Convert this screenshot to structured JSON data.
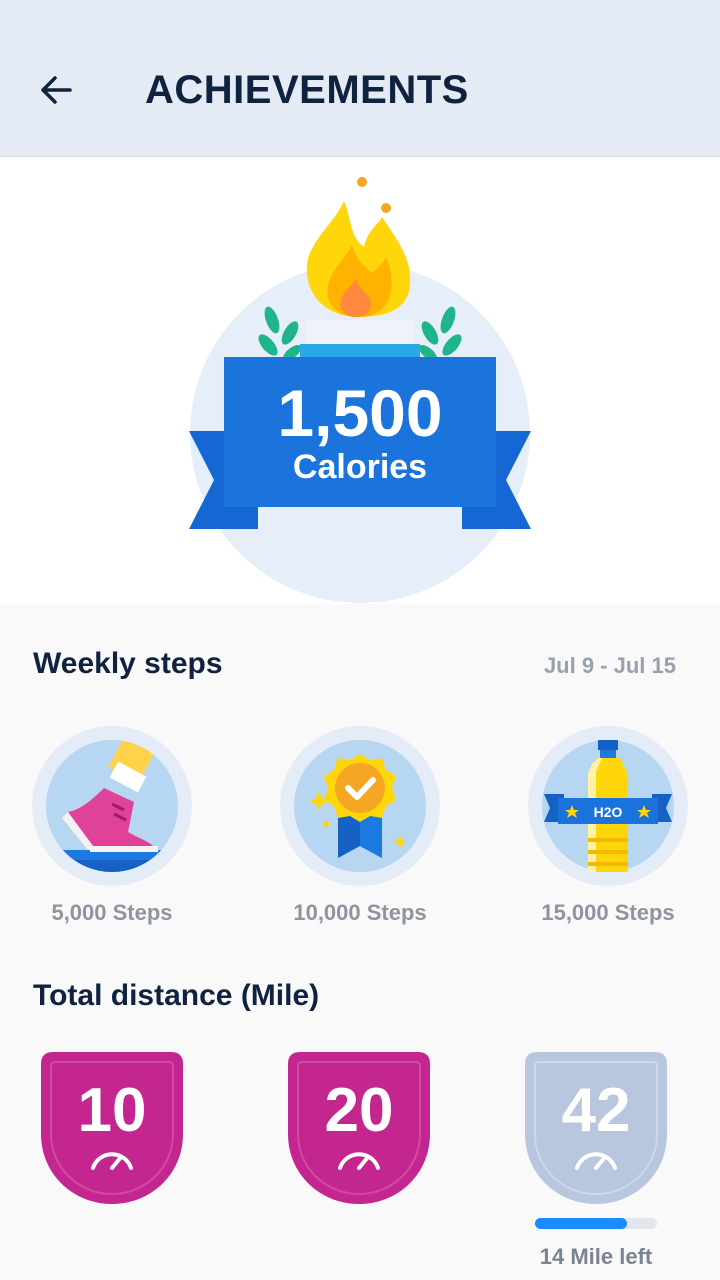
{
  "header": {
    "title": "ACHIEVEMENTS",
    "back_icon": "arrow-left-icon"
  },
  "hero": {
    "value": "1,500",
    "unit": "Calories",
    "icon": "torch-flame-icon"
  },
  "weekly_steps": {
    "title": "Weekly steps",
    "date_range": "Jul 9 - Jul 15",
    "badges": [
      {
        "label": "5,000 Steps",
        "icon": "sneaker-icon"
      },
      {
        "label": "10,000 Steps",
        "icon": "medal-check-icon"
      },
      {
        "label": "15,000 Steps",
        "icon": "water-bottle-icon",
        "bottle_text": "H2O"
      }
    ]
  },
  "total_distance": {
    "title": "Total distance (Mile)",
    "shields": [
      {
        "value": "10",
        "achieved": true
      },
      {
        "value": "20",
        "achieved": true
      },
      {
        "value": "42",
        "achieved": false
      }
    ],
    "progress": {
      "fraction": 0.75,
      "label": "14 Mile left"
    }
  },
  "colors": {
    "primary_blue": "#1568d3",
    "shield_achieved": "#c3268f",
    "shield_locked": "#b8c6de",
    "progress": "#1a8cff"
  }
}
